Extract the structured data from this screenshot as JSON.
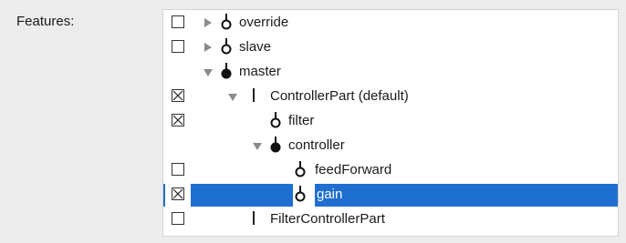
{
  "features_label": "Features:",
  "tree": {
    "rows": [
      {
        "label": "override",
        "checkbox": "unchecked",
        "toggle": "collapsed",
        "node": "open"
      },
      {
        "label": "slave",
        "checkbox": "unchecked",
        "toggle": "collapsed",
        "node": "open"
      },
      {
        "label": "master",
        "checkbox": "none",
        "toggle": "expanded",
        "node": "filled"
      },
      {
        "label": "ControllerPart (default)",
        "checkbox": "mixed",
        "toggle": "expanded",
        "node": "bar"
      },
      {
        "label": "filter",
        "checkbox": "mixed",
        "toggle": "none",
        "node": "open"
      },
      {
        "label": "controller",
        "checkbox": "none",
        "toggle": "expanded",
        "node": "filled"
      },
      {
        "label": "feedForward",
        "checkbox": "unchecked",
        "toggle": "none",
        "node": "open"
      },
      {
        "label": "gain",
        "checkbox": "mixed",
        "toggle": "none",
        "node": "open",
        "selected": true
      },
      {
        "label": "FilterControllerPart",
        "checkbox": "unchecked",
        "toggle": "none",
        "node": "bar"
      }
    ]
  },
  "colors": {
    "selection": "#1f6fd0",
    "background": "#ececec",
    "tree_background": "#ffffff"
  },
  "icons": {
    "open_node": "open-circle-node-icon",
    "filled_node": "filled-circle-node-icon",
    "bar_node": "vertical-bar-node-icon",
    "collapsed_toggle": "disclosure-right-icon",
    "expanded_toggle": "disclosure-down-icon",
    "mixed_checkbox": "x-mark-checkbox-icon"
  }
}
